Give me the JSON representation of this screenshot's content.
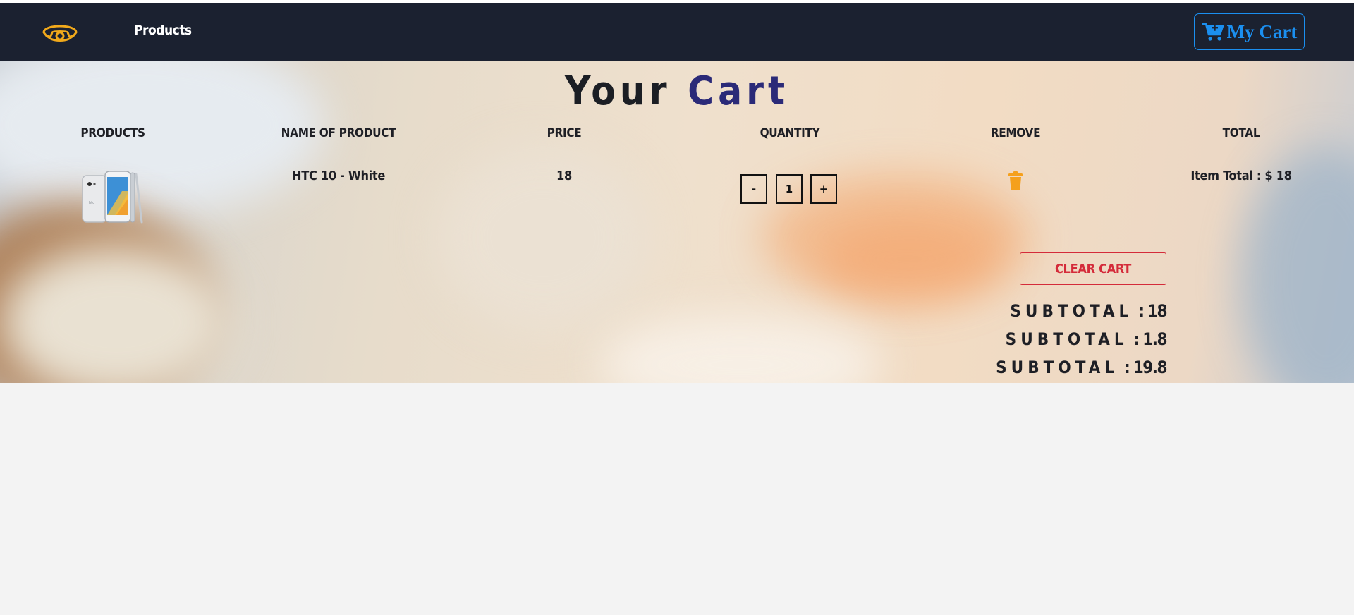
{
  "navbar": {
    "logo_icon": "phone-icon",
    "products_link": "Products",
    "cart_button": {
      "icon": "cart-plus-icon",
      "label": "My Cart"
    }
  },
  "cart": {
    "title_part1": "Your",
    "title_part2": "Cart",
    "columns": [
      "Products",
      "Name of Product",
      "Price",
      "Quantity",
      "Remove",
      "Total"
    ],
    "items": [
      {
        "image": "htc-10-white-phone",
        "name": "HTC 10 - White",
        "price": "18",
        "quantity": "1",
        "decrement_label": "-",
        "increment_label": "+",
        "remove_icon": "trash-icon",
        "item_total": "Item Total : $ 18"
      }
    ],
    "clear_button": "clear cart",
    "totals": [
      {
        "label": "SUBTOTAL",
        "value": "18"
      },
      {
        "label": "SUBTOTAL",
        "value": "1.8"
      },
      {
        "label": "SUBTOTAL",
        "value": "19.8"
      }
    ]
  },
  "colors": {
    "navbar_bg": "#1b2130",
    "cart_button": "#1b8ff0",
    "logo": "#f1a91b",
    "title_accent": "#2b2a78",
    "clear_button": "#d42b3a",
    "trash_icon": "#f5a01c"
  }
}
